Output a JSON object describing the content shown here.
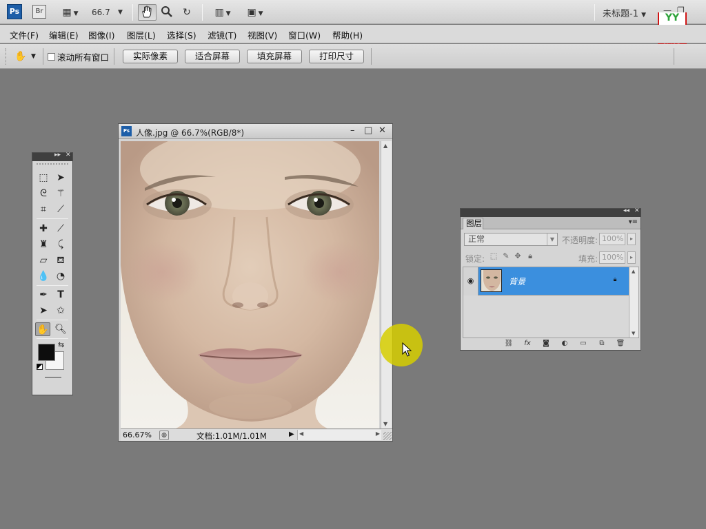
{
  "appbar": {
    "ps_logo": "Ps",
    "br_logo": "Br",
    "zoom_value": "66.7",
    "doc_name": "未标题-1",
    "icons": [
      "launch-bridge-icon",
      "view-extras-icon",
      "zoom-dropdown-icon",
      "hand-tool-icon",
      "zoom-tool-icon",
      "rotate-view-icon",
      "arrange-documents-icon",
      "screen-mode-icon",
      "minimize-icon",
      "restore-icon",
      "close-icon"
    ]
  },
  "brand": {
    "top": "YY",
    "line1": "育碟",
    "line2": "教育"
  },
  "menu": [
    "文件(F)",
    "编辑(E)",
    "图像(I)",
    "图层(L)",
    "选择(S)",
    "滤镜(T)",
    "视图(V)",
    "窗口(W)",
    "帮助(H)"
  ],
  "options": {
    "scroll_all_label": "滚动所有窗口",
    "scroll_all_checked": false,
    "buttons": [
      "实际像素",
      "适合屏幕",
      "填充屏幕",
      "打印尺寸"
    ]
  },
  "tools_panel": {
    "icons": [
      "rectangular-marquee-icon",
      "move-icon",
      "lasso-icon",
      "magic-wand-icon",
      "crop-icon",
      "eyedropper-icon",
      "healing-brush-icon",
      "brush-icon",
      "clone-stamp-icon",
      "history-brush-icon",
      "eraser-icon",
      "paint-bucket-icon",
      "blur-icon",
      "dodge-icon",
      "pen-icon",
      "type-icon",
      "path-selection-icon",
      "custom-shape-icon",
      "hand-icon",
      "zoom-icon"
    ],
    "foreground_color": "#0d0d0d",
    "background_color": "#f6f6f6"
  },
  "document": {
    "title": "人像.jpg @ 66.7%(RGB/8*)",
    "zoom_status": "66.67%",
    "doc_info": "文档:1.01M/1.01M"
  },
  "layers_panel": {
    "tab_label": "图层",
    "blend_mode": "正常",
    "opacity_label": "不透明度:",
    "opacity_value": "100%",
    "lock_label": "锁定:",
    "fill_label": "填充:",
    "fill_value": "100%",
    "layers": [
      {
        "name": "背景",
        "visible": true,
        "locked": true,
        "selected": true
      }
    ],
    "selection_color": "#3b8fde"
  }
}
